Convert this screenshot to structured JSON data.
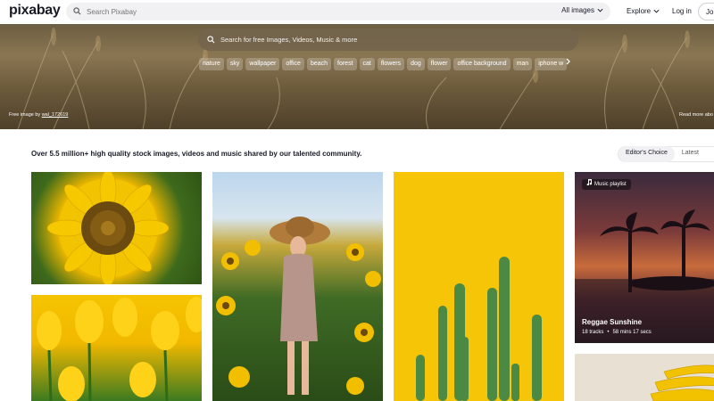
{
  "header": {
    "logo": "pixabay",
    "search_placeholder": "Search Pixabay",
    "type_select": "All images",
    "nav": {
      "explore": "Explore",
      "login": "Log in",
      "join": "Join"
    }
  },
  "hero": {
    "search_placeholder": "Search for free Images, Videos, Music & more",
    "chips": [
      "nature",
      "sky",
      "wallpaper",
      "office",
      "beach",
      "forest",
      "cat",
      "flowers",
      "dog",
      "flower",
      "office background",
      "man",
      "iphone w"
    ],
    "credit_prefix": "Free image by",
    "credit_author": "wal_172619",
    "read_more": "Read more abo"
  },
  "main": {
    "tagline": "Over 5.5 million+ high quality stock images, videos and music shared by our talented community.",
    "sort_tabs": [
      {
        "label": "Editor's Choice",
        "active": true
      },
      {
        "label": "Latest",
        "active": false
      }
    ]
  },
  "playlist_card": {
    "badge": "Music playlist",
    "title": "Reggae Sunshine",
    "tracks": "18 tracks",
    "bullet": "•",
    "duration": "58 mins 17 secs"
  },
  "colors": {
    "accent": "#00ab6b",
    "text": "#191b26",
    "hero_search": "#73644e"
  },
  "icons": {
    "search": "search-icon",
    "chevron": "chevron-down-icon",
    "music": "music-note-icon",
    "next": "chevron-right-icon"
  }
}
